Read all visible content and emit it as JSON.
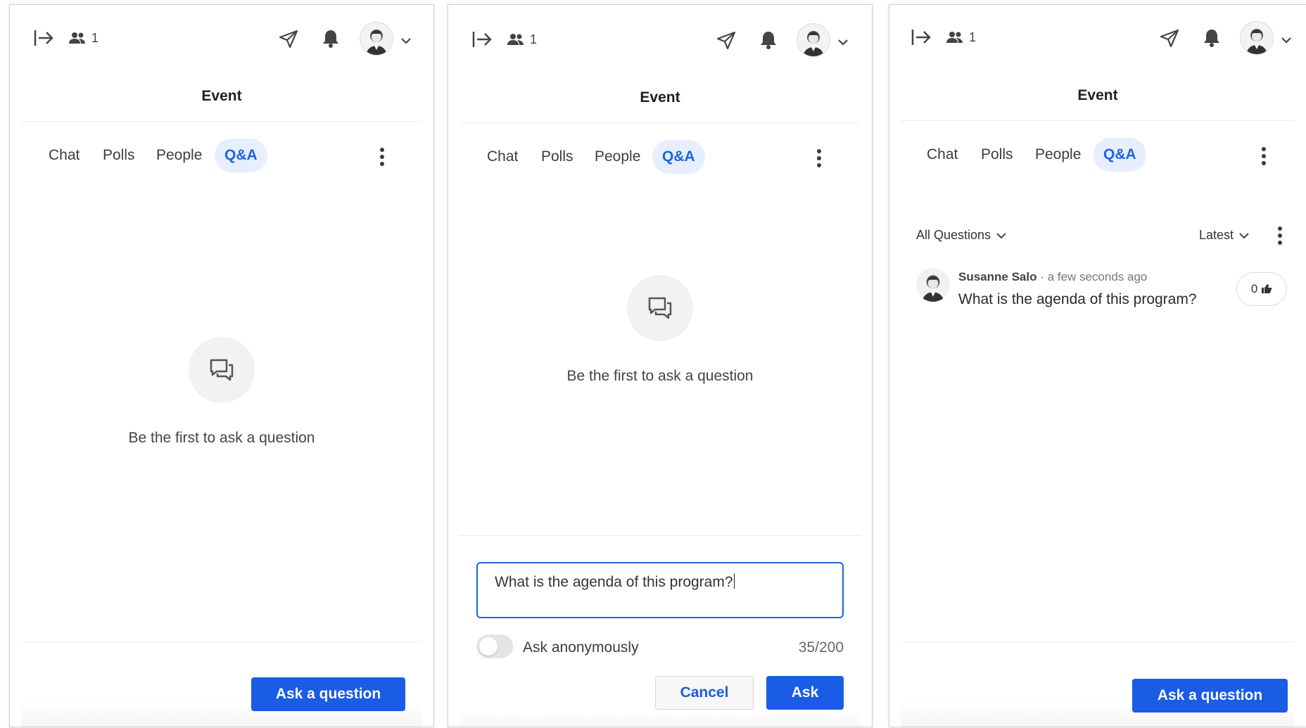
{
  "header": {
    "attendee_count": "1",
    "title": "Event",
    "icons": [
      "exit-panel-icon",
      "people-icon",
      "send-icon",
      "bell-icon",
      "avatar",
      "chevron-down-icon"
    ]
  },
  "tabs": {
    "chat": "Chat",
    "polls": "Polls",
    "people": "People",
    "qa": "Q&A",
    "active": "Q&A"
  },
  "empty_state": {
    "icon": "chat-bubbles-icon",
    "text": "Be the first to ask a question"
  },
  "panel1": {
    "ask_button": "Ask a question"
  },
  "panel2": {
    "question_input_value": "What is the agenda of this program?",
    "anonymous_label": "Ask anonymously",
    "anonymous_enabled": false,
    "char_counter": "35/200",
    "cancel_button": "Cancel",
    "ask_button": "Ask"
  },
  "panel3": {
    "filter_label": "All Questions",
    "sort_label": "Latest",
    "question": {
      "author": "Susanne Salo",
      "time": "· a few seconds ago",
      "text": "What is the agenda of this program?",
      "votes": "0"
    },
    "ask_button": "Ask a question"
  },
  "colors": {
    "accent": "#1a5ce5",
    "active_tab_bg": "#e7effe",
    "active_tab_text": "#1d64e0"
  }
}
